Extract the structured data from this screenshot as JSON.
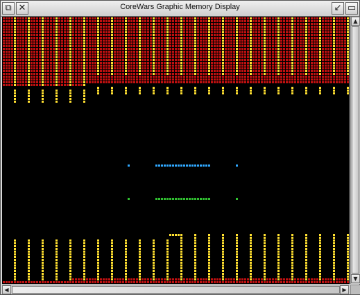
{
  "window": {
    "title": "CoreWars Graphic Memory Display",
    "icons": {
      "back": "back-icon",
      "close": "close-icon",
      "toggle_size": "toggle-size-icon",
      "iconise": "iconise-icon"
    }
  },
  "colors": {
    "background": "#000000",
    "empty": "#c01010",
    "program_a": "#ffe030",
    "program_b": "#30a8ff",
    "program_c": "#30c030"
  }
}
